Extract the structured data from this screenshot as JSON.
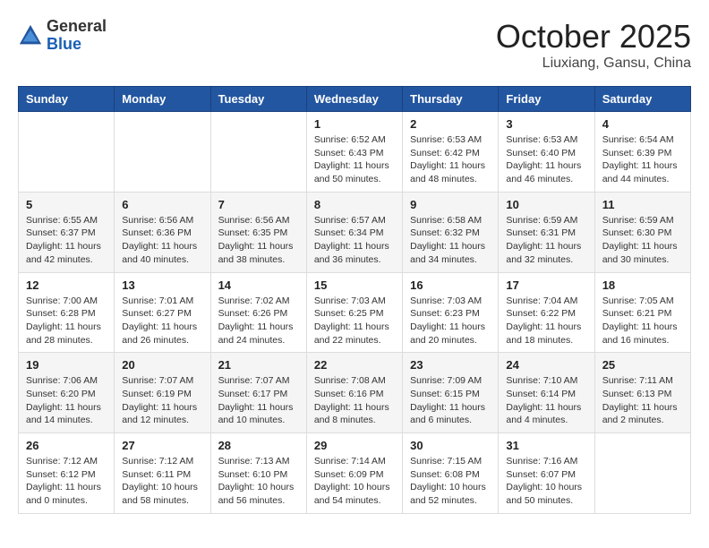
{
  "header": {
    "logo_general": "General",
    "logo_blue": "Blue",
    "month_title": "October 2025",
    "location": "Liuxiang, Gansu, China"
  },
  "days_of_week": [
    "Sunday",
    "Monday",
    "Tuesday",
    "Wednesday",
    "Thursday",
    "Friday",
    "Saturday"
  ],
  "weeks": [
    [
      {
        "day": "",
        "info": ""
      },
      {
        "day": "",
        "info": ""
      },
      {
        "day": "",
        "info": ""
      },
      {
        "day": "1",
        "info": "Sunrise: 6:52 AM\nSunset: 6:43 PM\nDaylight: 11 hours\nand 50 minutes."
      },
      {
        "day": "2",
        "info": "Sunrise: 6:53 AM\nSunset: 6:42 PM\nDaylight: 11 hours\nand 48 minutes."
      },
      {
        "day": "3",
        "info": "Sunrise: 6:53 AM\nSunset: 6:40 PM\nDaylight: 11 hours\nand 46 minutes."
      },
      {
        "day": "4",
        "info": "Sunrise: 6:54 AM\nSunset: 6:39 PM\nDaylight: 11 hours\nand 44 minutes."
      }
    ],
    [
      {
        "day": "5",
        "info": "Sunrise: 6:55 AM\nSunset: 6:37 PM\nDaylight: 11 hours\nand 42 minutes."
      },
      {
        "day": "6",
        "info": "Sunrise: 6:56 AM\nSunset: 6:36 PM\nDaylight: 11 hours\nand 40 minutes."
      },
      {
        "day": "7",
        "info": "Sunrise: 6:56 AM\nSunset: 6:35 PM\nDaylight: 11 hours\nand 38 minutes."
      },
      {
        "day": "8",
        "info": "Sunrise: 6:57 AM\nSunset: 6:34 PM\nDaylight: 11 hours\nand 36 minutes."
      },
      {
        "day": "9",
        "info": "Sunrise: 6:58 AM\nSunset: 6:32 PM\nDaylight: 11 hours\nand 34 minutes."
      },
      {
        "day": "10",
        "info": "Sunrise: 6:59 AM\nSunset: 6:31 PM\nDaylight: 11 hours\nand 32 minutes."
      },
      {
        "day": "11",
        "info": "Sunrise: 6:59 AM\nSunset: 6:30 PM\nDaylight: 11 hours\nand 30 minutes."
      }
    ],
    [
      {
        "day": "12",
        "info": "Sunrise: 7:00 AM\nSunset: 6:28 PM\nDaylight: 11 hours\nand 28 minutes."
      },
      {
        "day": "13",
        "info": "Sunrise: 7:01 AM\nSunset: 6:27 PM\nDaylight: 11 hours\nand 26 minutes."
      },
      {
        "day": "14",
        "info": "Sunrise: 7:02 AM\nSunset: 6:26 PM\nDaylight: 11 hours\nand 24 minutes."
      },
      {
        "day": "15",
        "info": "Sunrise: 7:03 AM\nSunset: 6:25 PM\nDaylight: 11 hours\nand 22 minutes."
      },
      {
        "day": "16",
        "info": "Sunrise: 7:03 AM\nSunset: 6:23 PM\nDaylight: 11 hours\nand 20 minutes."
      },
      {
        "day": "17",
        "info": "Sunrise: 7:04 AM\nSunset: 6:22 PM\nDaylight: 11 hours\nand 18 minutes."
      },
      {
        "day": "18",
        "info": "Sunrise: 7:05 AM\nSunset: 6:21 PM\nDaylight: 11 hours\nand 16 minutes."
      }
    ],
    [
      {
        "day": "19",
        "info": "Sunrise: 7:06 AM\nSunset: 6:20 PM\nDaylight: 11 hours\nand 14 minutes."
      },
      {
        "day": "20",
        "info": "Sunrise: 7:07 AM\nSunset: 6:19 PM\nDaylight: 11 hours\nand 12 minutes."
      },
      {
        "day": "21",
        "info": "Sunrise: 7:07 AM\nSunset: 6:17 PM\nDaylight: 11 hours\nand 10 minutes."
      },
      {
        "day": "22",
        "info": "Sunrise: 7:08 AM\nSunset: 6:16 PM\nDaylight: 11 hours\nand 8 minutes."
      },
      {
        "day": "23",
        "info": "Sunrise: 7:09 AM\nSunset: 6:15 PM\nDaylight: 11 hours\nand 6 minutes."
      },
      {
        "day": "24",
        "info": "Sunrise: 7:10 AM\nSunset: 6:14 PM\nDaylight: 11 hours\nand 4 minutes."
      },
      {
        "day": "25",
        "info": "Sunrise: 7:11 AM\nSunset: 6:13 PM\nDaylight: 11 hours\nand 2 minutes."
      }
    ],
    [
      {
        "day": "26",
        "info": "Sunrise: 7:12 AM\nSunset: 6:12 PM\nDaylight: 11 hours\nand 0 minutes."
      },
      {
        "day": "27",
        "info": "Sunrise: 7:12 AM\nSunset: 6:11 PM\nDaylight: 10 hours\nand 58 minutes."
      },
      {
        "day": "28",
        "info": "Sunrise: 7:13 AM\nSunset: 6:10 PM\nDaylight: 10 hours\nand 56 minutes."
      },
      {
        "day": "29",
        "info": "Sunrise: 7:14 AM\nSunset: 6:09 PM\nDaylight: 10 hours\nand 54 minutes."
      },
      {
        "day": "30",
        "info": "Sunrise: 7:15 AM\nSunset: 6:08 PM\nDaylight: 10 hours\nand 52 minutes."
      },
      {
        "day": "31",
        "info": "Sunrise: 7:16 AM\nSunset: 6:07 PM\nDaylight: 10 hours\nand 50 minutes."
      },
      {
        "day": "",
        "info": ""
      }
    ]
  ]
}
